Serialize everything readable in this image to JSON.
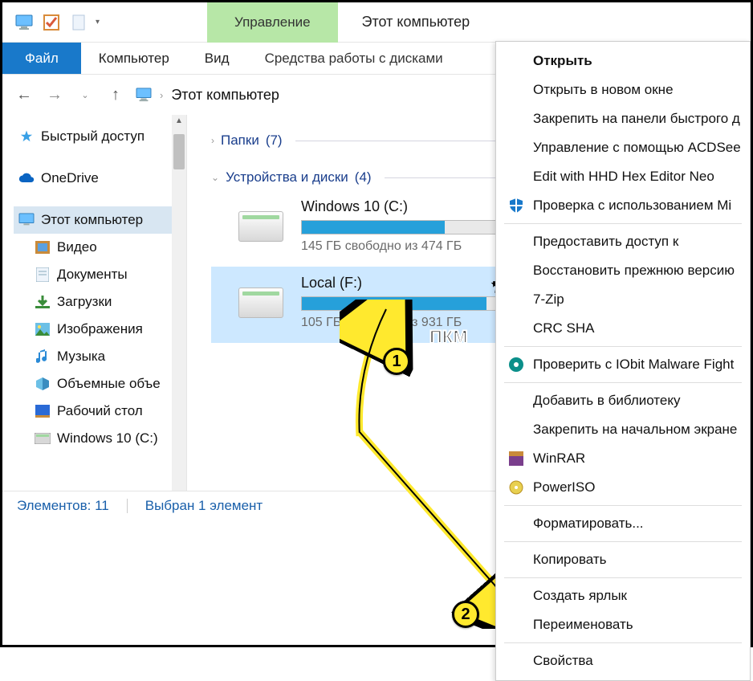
{
  "window": {
    "title": "Этот компьютер"
  },
  "ribbon": {
    "manage": "Управление",
    "file": "Файл",
    "computer": "Компьютер",
    "view": "Вид",
    "drive_tools": "Средства работы с дисками"
  },
  "address": {
    "root": "Этот компьютер"
  },
  "nav": {
    "quick_access": "Быстрый доступ",
    "onedrive": "OneDrive",
    "this_pc": "Этот компьютер",
    "video": "Видео",
    "documents": "Документы",
    "downloads": "Загрузки",
    "pictures": "Изображения",
    "music": "Музыка",
    "desktop3d": "Объемные объе",
    "desktop": "Рабочий стол",
    "drive_c": "Windows 10 (C:)"
  },
  "groups": {
    "folders": {
      "label": "Папки",
      "count": "(7)"
    },
    "drives": {
      "label": "Устройства и диски",
      "count": "(4)"
    }
  },
  "drives": [
    {
      "name": "Windows 10 (C:)",
      "free": "145 ГБ свободно из 474 ГБ",
      "fill_pct": 69
    },
    {
      "name": "Local (F:)",
      "free": "105 ГБ свободно из 931 ГБ",
      "fill_pct": 89
    }
  ],
  "status": {
    "items": "Элементов: 11",
    "selected": "Выбран 1 элемент"
  },
  "ctx": {
    "open": "Открыть",
    "open_new": "Открыть в новом окне",
    "pin_quick": "Закрепить на панели быстрого д",
    "acdsee": "Управление с помощью ACDSee",
    "hexedit": "Edit with HHD Hex Editor Neo",
    "defender": "Проверка с использованием Mi",
    "share": "Предоставить доступ к",
    "restore": "Восстановить прежнюю версию",
    "sevenzip": "7-Zip",
    "crcsha": "CRC SHA",
    "iobit": "Проверить с IObit Malware Fight",
    "addlib": "Добавить в библиотеку",
    "pin_start": "Закрепить на начальном экране",
    "winrar": "WinRAR",
    "poweriso": "PowerISO",
    "format": "Форматировать...",
    "copy": "Копировать",
    "shortcut": "Создать ярлык",
    "rename": "Переименовать",
    "properties": "Свойства"
  },
  "annot": {
    "pkm": "ПКМ",
    "m1": "1",
    "m2": "2"
  }
}
